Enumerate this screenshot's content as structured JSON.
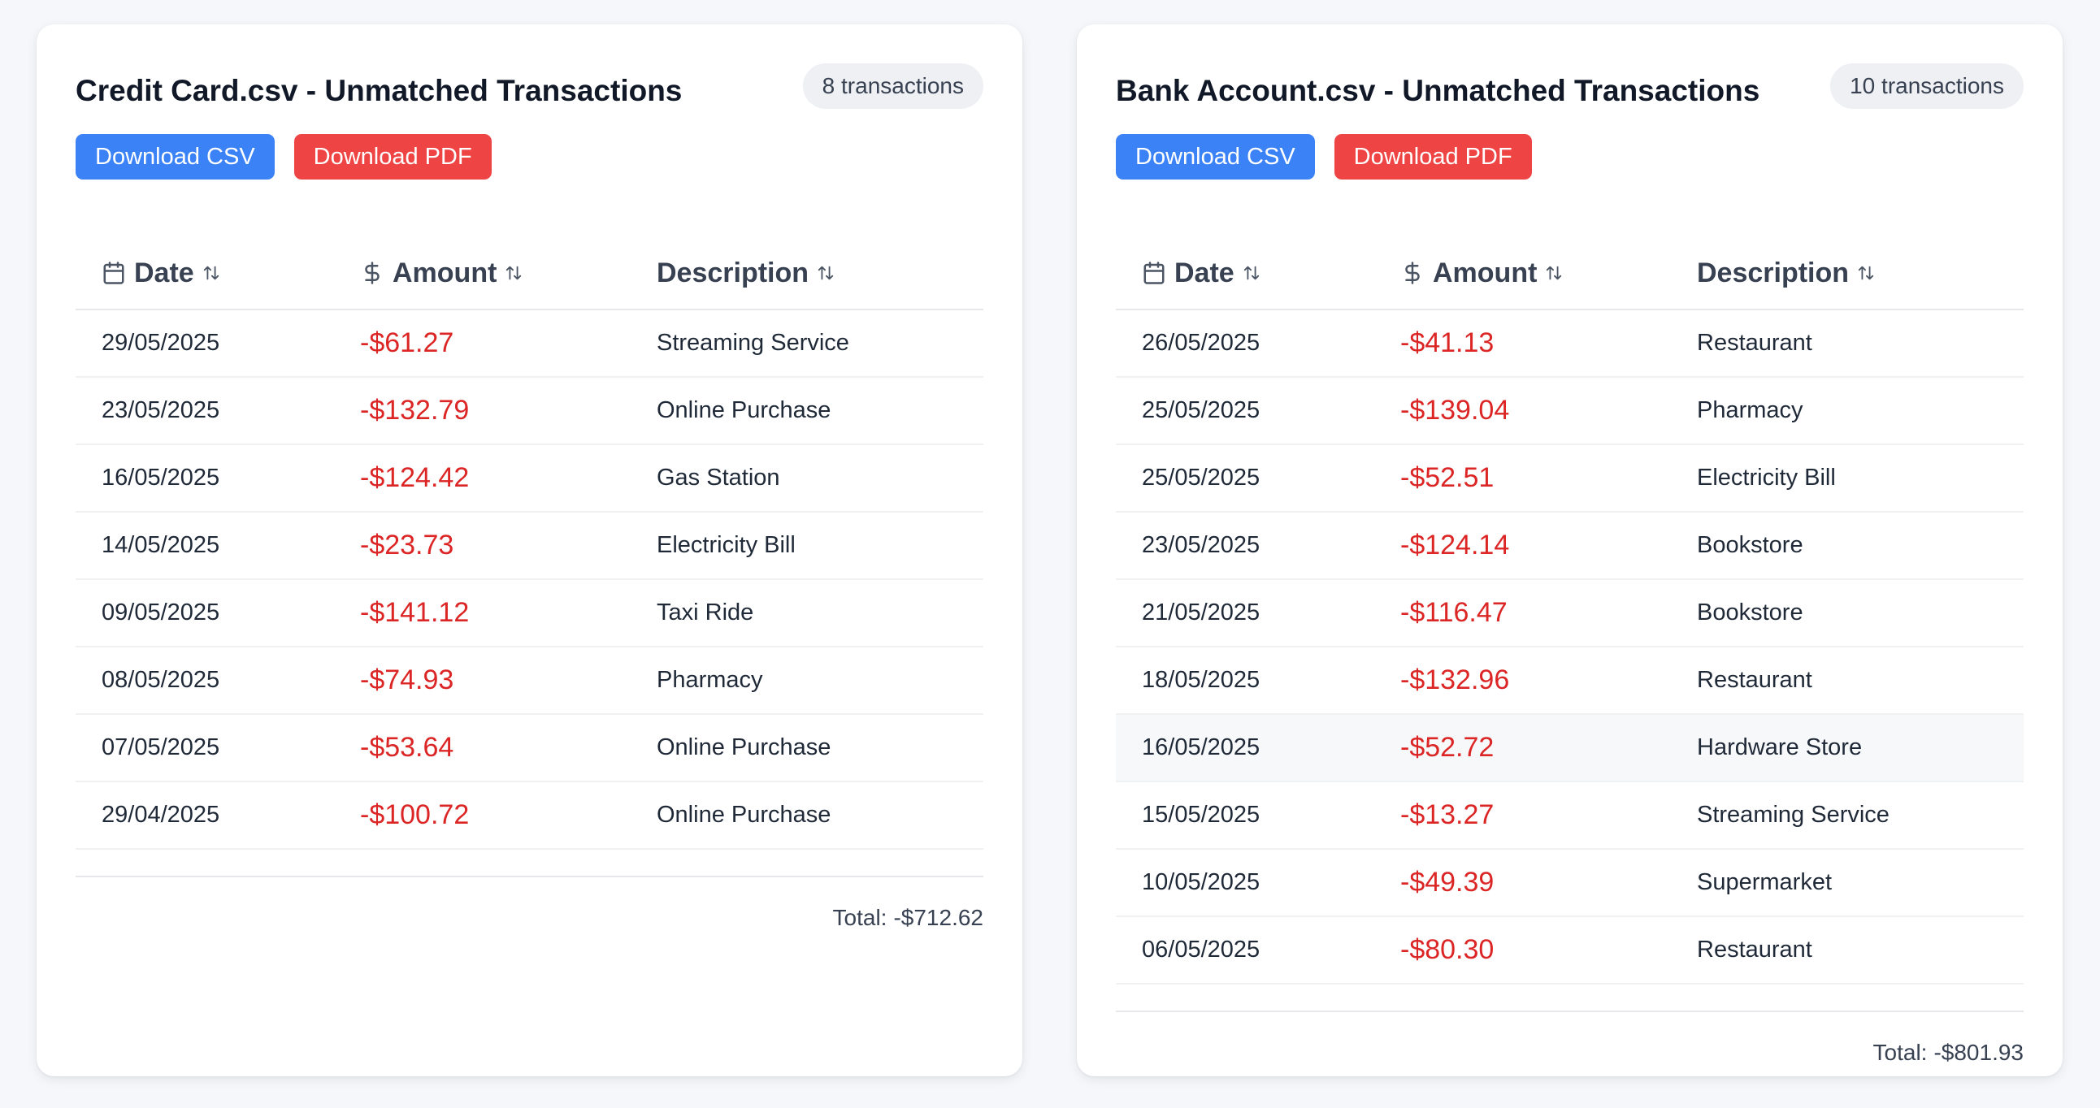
{
  "theme": {
    "primary_button": "#3b82f6",
    "danger_button": "#ef4444",
    "negative_amount": "#dc2626",
    "background": "#f5f7fa"
  },
  "icons": {
    "date_header": "calendar-icon",
    "amount_header": "dollar-icon",
    "sort": "sort-arrows-icon"
  },
  "columns": {
    "date": "Date",
    "amount": "Amount",
    "description": "Description"
  },
  "buttons": {
    "csv": "Download CSV",
    "pdf": "Download PDF"
  },
  "total_label": "Total:",
  "cards": [
    {
      "title": "Credit Card.csv - Unmatched Transactions",
      "count": "8 transactions",
      "total": "-$712.62",
      "rows": [
        {
          "date": "29/05/2025",
          "amount": "-$61.27",
          "description": "Streaming Service"
        },
        {
          "date": "23/05/2025",
          "amount": "-$132.79",
          "description": "Online Purchase"
        },
        {
          "date": "16/05/2025",
          "amount": "-$124.42",
          "description": "Gas Station"
        },
        {
          "date": "14/05/2025",
          "amount": "-$23.73",
          "description": "Electricity Bill"
        },
        {
          "date": "09/05/2025",
          "amount": "-$141.12",
          "description": "Taxi Ride"
        },
        {
          "date": "08/05/2025",
          "amount": "-$74.93",
          "description": "Pharmacy"
        },
        {
          "date": "07/05/2025",
          "amount": "-$53.64",
          "description": "Online Purchase"
        },
        {
          "date": "29/04/2025",
          "amount": "-$100.72",
          "description": "Online Purchase"
        }
      ]
    },
    {
      "title": "Bank Account.csv - Unmatched Transactions",
      "count": "10 transactions",
      "total": "-$801.93",
      "rows": [
        {
          "date": "26/05/2025",
          "amount": "-$41.13",
          "description": "Restaurant"
        },
        {
          "date": "25/05/2025",
          "amount": "-$139.04",
          "description": "Pharmacy"
        },
        {
          "date": "25/05/2025",
          "amount": "-$52.51",
          "description": "Electricity Bill"
        },
        {
          "date": "23/05/2025",
          "amount": "-$124.14",
          "description": "Bookstore"
        },
        {
          "date": "21/05/2025",
          "amount": "-$116.47",
          "description": "Bookstore"
        },
        {
          "date": "18/05/2025",
          "amount": "-$132.96",
          "description": "Restaurant"
        },
        {
          "date": "16/05/2025",
          "amount": "-$52.72",
          "description": "Hardware Store",
          "hovered": true
        },
        {
          "date": "15/05/2025",
          "amount": "-$13.27",
          "description": "Streaming Service"
        },
        {
          "date": "10/05/2025",
          "amount": "-$49.39",
          "description": "Supermarket"
        },
        {
          "date": "06/05/2025",
          "amount": "-$80.30",
          "description": "Restaurant"
        }
      ]
    }
  ]
}
